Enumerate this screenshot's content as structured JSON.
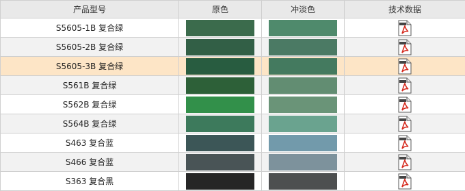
{
  "columns": {
    "model": "产品型号",
    "original": "原色",
    "tint": "冲淡色",
    "datasheet": "技术数据"
  },
  "rows": [
    {
      "model": "S5605-1B 复合绿",
      "original_color": "#3b6b4c",
      "tint_color": "#4f8a6c",
      "highlighted": false
    },
    {
      "model": "S5605-2B 复合绿",
      "original_color": "#325f46",
      "tint_color": "#4b7a64",
      "highlighted": false
    },
    {
      "model": "S5605-3B 复合绿",
      "original_color": "#285c40",
      "tint_color": "#447a5f",
      "highlighted": true
    },
    {
      "model": "S561B 复合绿",
      "original_color": "#2d6038",
      "tint_color": "#628d72",
      "highlighted": false
    },
    {
      "model": "S562B 复合绿",
      "original_color": "#32904a",
      "tint_color": "#6a9478",
      "highlighted": false
    },
    {
      "model": "S564B 复合绿",
      "original_color": "#3d7a5c",
      "tint_color": "#6aa38f",
      "highlighted": false
    },
    {
      "model": "S463 复合蓝",
      "original_color": "#3c5657",
      "tint_color": "#729aab",
      "highlighted": false
    },
    {
      "model": "S466 复合蓝",
      "original_color": "#495456",
      "tint_color": "#7d929c",
      "highlighted": false
    },
    {
      "model": "S363 复合黑",
      "original_color": "#262626",
      "tint_color": "#4d4f50",
      "highlighted": false
    }
  ],
  "icons": {
    "datasheet": "pdf-file-icon"
  },
  "colors": {
    "highlight": "#fde5c6",
    "header_bg": "#e9e9e9",
    "alt_row": "#f2f2f2",
    "pdf_red": "#d62b1f"
  }
}
